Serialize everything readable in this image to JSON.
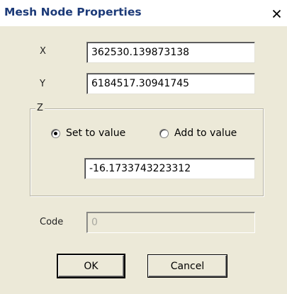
{
  "window": {
    "title": "Mesh Node Properties",
    "close_icon": "close-icon"
  },
  "fields": {
    "x_label": "X",
    "x_value": "362530.139873138",
    "y_label": "Y",
    "y_value": "6184517.30941745"
  },
  "z_group": {
    "label": "Z",
    "set_to_value_label": "Set to value",
    "add_to_value_label": "Add to value",
    "selected_option": "Set to value",
    "value": "-16.1733743223312"
  },
  "code": {
    "label": "Code",
    "value": "0"
  },
  "buttons": {
    "ok_label": "OK",
    "cancel_label": "Cancel"
  },
  "colors": {
    "title_text": "#1c3a78",
    "dialog_background": "#ece9d8"
  }
}
